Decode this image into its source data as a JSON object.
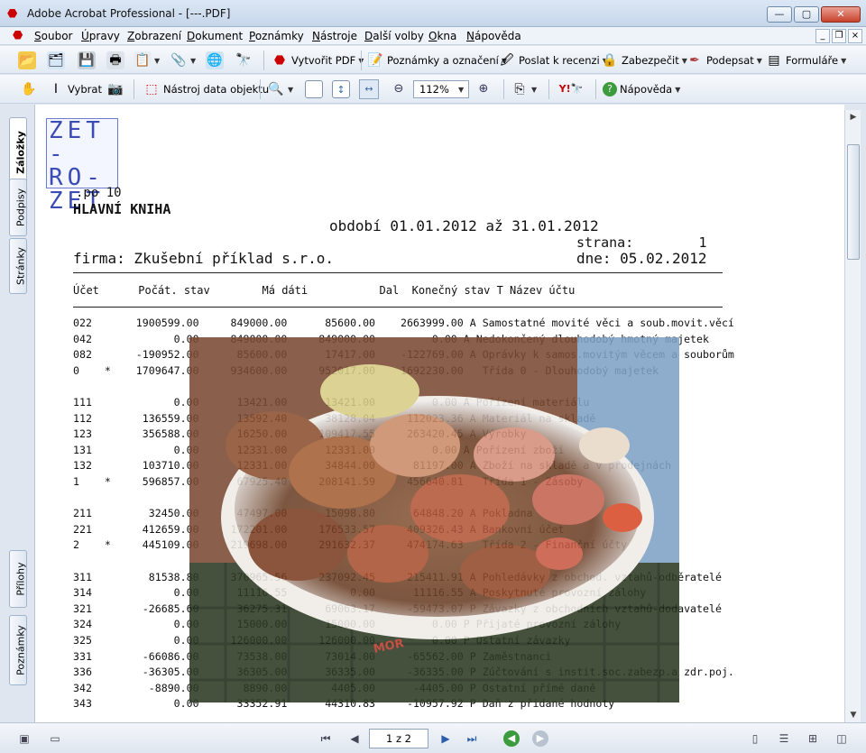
{
  "window": {
    "title": "Adobe Acrobat Professional - [---.PDF]",
    "buttons": {
      "minimize": "—",
      "maximize": "▢",
      "close": "✕"
    }
  },
  "menu": [
    "Soubor",
    "Úpravy",
    "Zobrazení",
    "Dokument",
    "Poznámky",
    "Nástroje",
    "Další volby",
    "Okna",
    "Nápověda"
  ],
  "toolbar1": {
    "create_pdf": "Vytvořit PDF",
    "comments": "Poznámky a označení",
    "send_review": "Poslat k recenzi",
    "secure": "Zabezpečit",
    "sign": "Podepsat",
    "forms": "Formuláře"
  },
  "toolbar2": {
    "select": "Vybrat",
    "object_data": "Nástroj data objektu",
    "zoom": "112%",
    "help": "Nápověda"
  },
  "left_tabs": [
    "Záložky",
    "Podpisy",
    "Stránky",
    "Přílohy",
    "Poznámky"
  ],
  "document": {
    "logo_lines": [
      "ZET",
      "-RO-",
      "ZET"
    ],
    "logo_sub": ".po 10",
    "heading": "HLAVNÍ KNIHA",
    "period": "období 01.01.2012 až 31.01.2012",
    "page_label": "strana:        1",
    "company": "firma: Zkušební příklad s.r.o.",
    "date": "dne: 05.02.2012",
    "columns": "Účet      Počát. stav        Má dáti           Dal  Konečný stav T Název účtu",
    "rows": [
      "022       1900599.00     849000.00      85600.00    2663999.00 A Samostatné movité věci a soub.movit.věcí",
      "042             0.00     849000.00     849000.00         0.00 A Nedokončený dlouhodobý hmotný majetek",
      "082       -190952.00      85600.00      17417.00    -122769.00 A Oprávky k samos.movitým věcem a souborům",
      "0    *    1709647.00     934600.00     952017.00    1692230.00   Třída 0 - Dlouhodobý majetek",
      "",
      "111             0.00      13421.00      13421.00         0.00 A Pořízení materiálu",
      "112        136559.00      13592.40      38128.04     112023.36 A Materiál na skladě",
      "123        356588.00      16250.00     109417.55     263420.45 A Výrobky",
      "131             0.00      12331.00      12331.00         0.00 A Pořízení zboží",
      "132        103710.00      12331.00      34844.00      81197.00 A Zboží na skladě a v prodejnách",
      "1    *     596857.00      67925.40     208141.59     456640.81   Třída 1 - Zásoby",
      "",
      "211         32450.00      47497.00      15098.80      64848.20 A Pokladna",
      "221        412659.00     172201.00     176533.57     409326.43 A Bankovní účet",
      "2    *     445109.00     219698.00     291632.37     474174.63   Třída 2 - Finanční účty",
      "",
      "311         81538.80     370965.56     237092.45     215411.91 A Pohledávky z obchod. vztahů-odběratelé",
      "314             0.00      11116.55          0.00      11116.55 A Poskytnuté provozní zálohy",
      "321        -26685.60      36275.31      69063.17     -59473.07 P Závazky z obchodních vztahů-dodavatelé",
      "324             0.00      15000.00      15000.00         0.00 P Přijaté provozní zálohy",
      "325             0.00     126000.00     126000.00         0.00 P Ostatní závazky",
      "331        -66086.00      73538.00      73014.00     -65562.00 P Zaměstnanci",
      "336        -36305.00      36305.00      36335.00     -36335.00 P Zúčtování s instit.soc.zabezp.a zdr.poj.",
      "342         -8890.00       8890.00       4405.00      -4405.00 P Ostatní přímé daně",
      "343             0.00      33352.91      44310.83     -10957.92 P Daň z přidané hodnoty"
    ]
  },
  "statusbar": {
    "page": "1 z 2"
  }
}
